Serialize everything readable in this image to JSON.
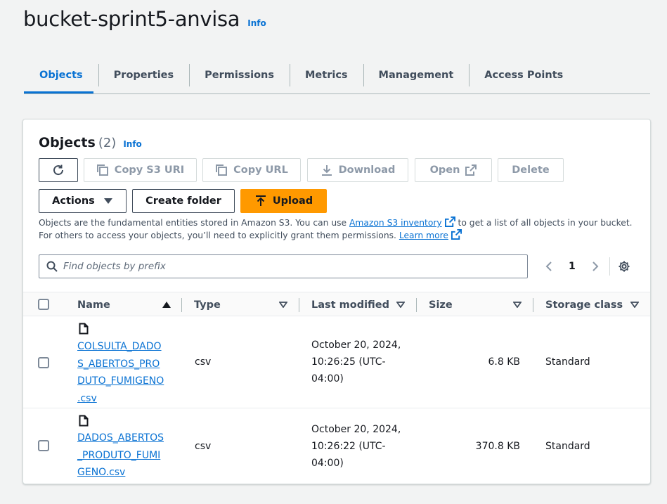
{
  "bucket": {
    "title": "bucket-sprint5-anvisa",
    "info": "Info"
  },
  "tabs": [
    {
      "label": "Objects",
      "active": true
    },
    {
      "label": "Properties"
    },
    {
      "label": "Permissions"
    },
    {
      "label": "Metrics"
    },
    {
      "label": "Management"
    },
    {
      "label": "Access Points"
    }
  ],
  "objects_panel": {
    "title": "Objects",
    "count": "(2)",
    "info": "Info",
    "buttons": {
      "refresh_icon": "refresh-icon",
      "copy_s3_uri": "Copy S3 URI",
      "copy_url": "Copy URL",
      "download": "Download",
      "open": "Open",
      "delete": "Delete",
      "actions": "Actions",
      "create_folder": "Create folder",
      "upload": "Upload"
    },
    "description": {
      "part1": "Objects are the fundamental entities stored in Amazon S3. You can use ",
      "link1": "Amazon S3 inventory",
      "part2": " to get a list of all objects in your bucket. For others to access your objects, you’ll need to explicitly grant them permissions. ",
      "link2": "Learn more"
    },
    "search": {
      "placeholder": "Find objects by prefix",
      "value": ""
    },
    "pagination": {
      "current_page": "1"
    }
  },
  "table": {
    "columns": [
      "Name",
      "Type",
      "Last modified",
      "Size",
      "Storage class"
    ],
    "rows": [
      {
        "name": "COLSULTA_DADO\nS_ABERTOS_PRO\nDUTO_FUMIGENO\n.csv",
        "type": "csv",
        "last_modified": "October 20, 2024,\n10:26:25 (UTC-\n04:00)",
        "size": "6.8 KB",
        "storage_class": "Standard"
      },
      {
        "name": "DADOS_ABERTOS\n_PRODUTO_FUMI\nGENO.csv",
        "type": "csv",
        "last_modified": "October 20, 2024,\n10:26:22 (UTC-\n04:00)",
        "size": "370.8 KB",
        "storage_class": "Standard"
      }
    ]
  },
  "colors": {
    "accent": "#0972d3",
    "primary_button": "#ff9900",
    "background": "#f2f3f3"
  }
}
